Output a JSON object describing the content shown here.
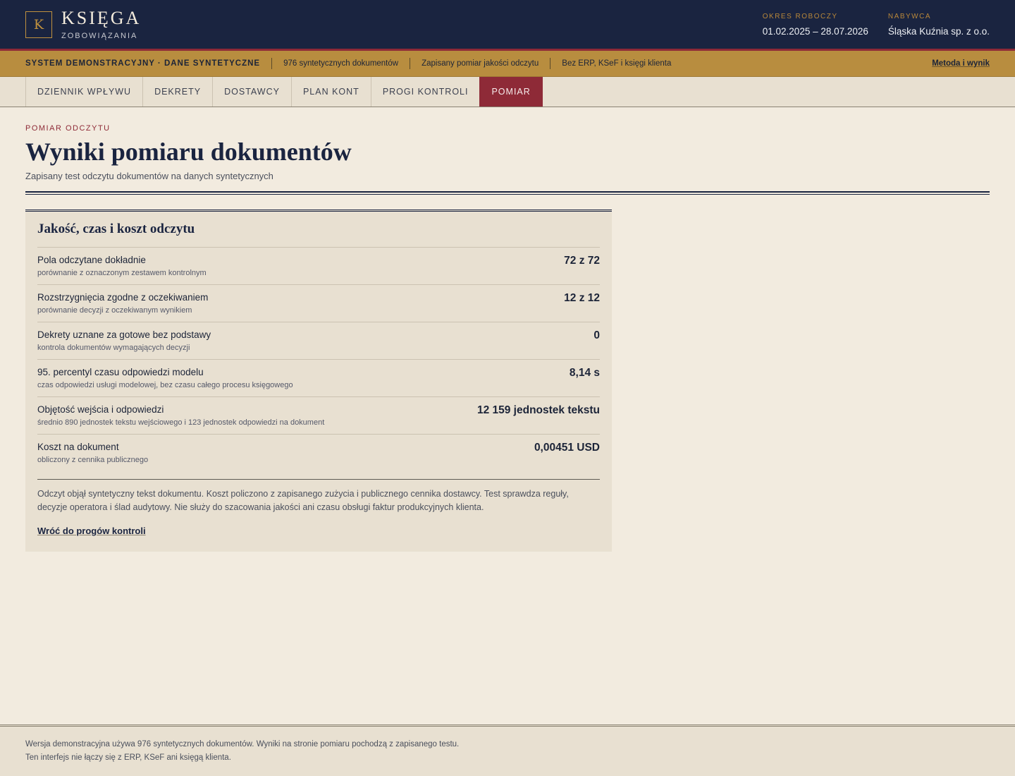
{
  "header": {
    "logo_letter": "K",
    "title": "KSIĘGA",
    "subtitle": "ZOBOWIĄZANIA",
    "period_label": "OKRES ROBOCZY",
    "period_value": "01.02.2025 – 28.07.2026",
    "buyer_label": "NABYWCA",
    "buyer_value": "Śląska Kuźnia sp. z o.o."
  },
  "banner": {
    "system": "SYSTEM DEMONSTRACYJNY · DANE SYNTETYCZNE",
    "docs": "976 syntetycznych dokumentów",
    "measurement": "Zapisany pomiar jakości odczytu",
    "scope": "Bez ERP, KSeF i księgi klienta",
    "link": "Metoda i wynik"
  },
  "tabs": [
    {
      "label": "DZIENNIK WPŁYWU"
    },
    {
      "label": "DEKRETY"
    },
    {
      "label": "DOSTAWCY"
    },
    {
      "label": "PLAN KONT"
    },
    {
      "label": "PROGI KONTROLI"
    },
    {
      "label": "POMIAR",
      "active": true
    }
  ],
  "page": {
    "kicker": "POMIAR ODCZYTU",
    "title": "Wyniki pomiaru dokumentów",
    "subtitle": "Zapisany test odczytu dokumentów na danych syntetycznych"
  },
  "card": {
    "title": "Jakość, czas i koszt odczytu",
    "rows": [
      {
        "label": "Pola odczytane dokładnie",
        "desc": "porównanie z oznaczonym zestawem kontrolnym",
        "value": "72 z 72"
      },
      {
        "label": "Rozstrzygnięcia zgodne z oczekiwaniem",
        "desc": "porównanie decyzji z oczekiwanym wynikiem",
        "value": "12 z 12"
      },
      {
        "label": "Dekrety uznane za gotowe bez podstawy",
        "desc": "kontrola dokumentów wymagających decyzji",
        "value": "0"
      },
      {
        "label": "95. percentyl czasu odpowiedzi modelu",
        "desc": "czas odpowiedzi usługi modelowej, bez czasu całego procesu księgowego",
        "value": "8,14 s"
      },
      {
        "label": "Objętość wejścia i odpowiedzi",
        "desc": "średnio 890 jednostek tekstu wejściowego i 123 jednostek odpowiedzi na dokument",
        "value": "12 159 jednostek tekstu"
      },
      {
        "label": "Koszt na dokument",
        "desc": "obliczony z cennika publicznego",
        "value": "0,00451 USD"
      }
    ],
    "note": "Odczyt objął syntetyczny tekst dokumentu. Koszt policzono z zapisanego zużycia i publicznego cennika dostawcy. Test sprawdza reguły, decyzje operatora i ślad audytowy. Nie służy do szacowania jakości ani czasu obsługi faktur produkcyjnych klienta.",
    "back_link": "Wróć do progów kontroli"
  },
  "footer": {
    "line1": "Wersja demonstracyjna używa 976 syntetycznych dokumentów. Wyniki na stronie pomiaru pochodzą z zapisanego testu.",
    "line2": "Ten interfejs nie łączy się z ERP, KSeF ani księgą klienta."
  },
  "colors": {
    "navy": "#1a2440",
    "gold": "#b88d3f",
    "crimson": "#8e2a37",
    "paper": "#f2ebdf",
    "card": "#e8e0d1"
  }
}
